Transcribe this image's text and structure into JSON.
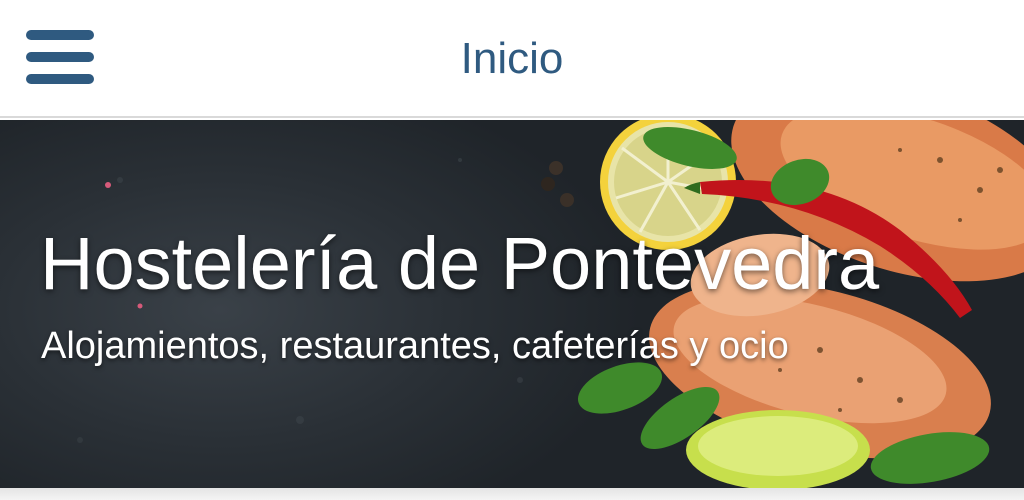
{
  "header": {
    "title": "Inicio",
    "menu_icon": "hamburger-menu-icon",
    "accent_color": "#2f5a80"
  },
  "hero": {
    "title": "Hostelería de Pontevedra",
    "subtitle": "Alojamientos, restaurantes, cafeterías y ocio",
    "image_subject": "food-photo"
  }
}
